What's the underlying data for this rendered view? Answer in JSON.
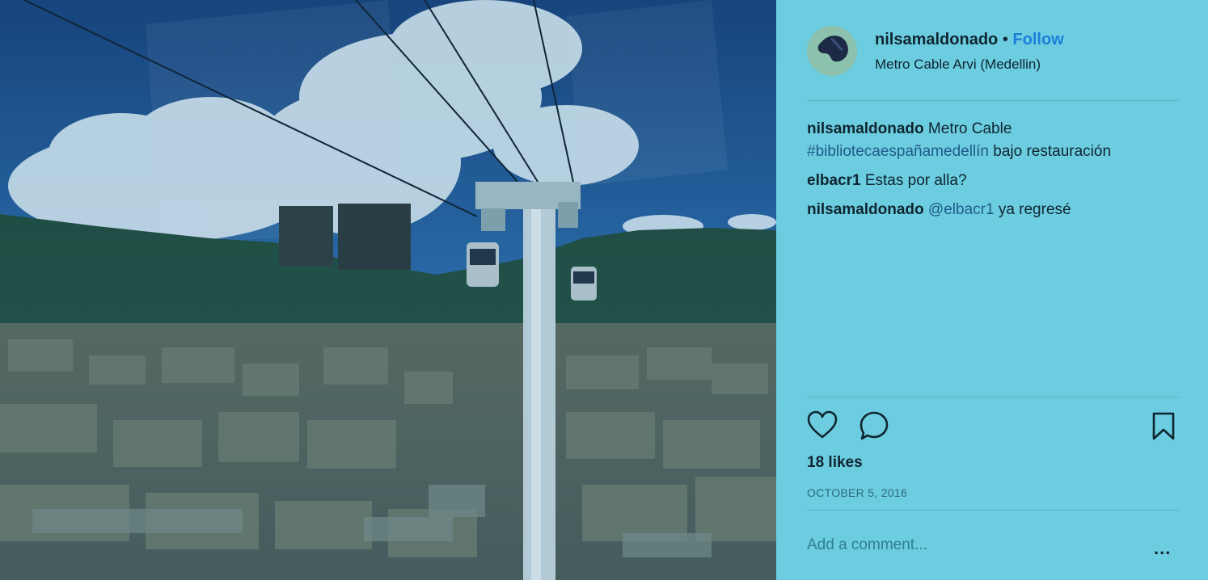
{
  "post": {
    "username": "nilsamaldonado",
    "separator": "•",
    "follow_label": "Follow",
    "location": "Metro Cable Arvi (Medellin)"
  },
  "comments": [
    {
      "user": "nilsamaldonado",
      "text_1": "Metro Cable",
      "hashtag": "#bibliotecaespañamedellín",
      "text_2": "bajo restauración"
    },
    {
      "user": "elbacr1",
      "text": "Estas por alla?"
    },
    {
      "user": "nilsamaldonado",
      "mention": "@elbacr1",
      "text": "ya regresé"
    }
  ],
  "stats": {
    "likes": "18 likes",
    "date": "OCTOBER 5, 2016"
  },
  "comment_box": {
    "placeholder": "Add a comment...",
    "more_label": "..."
  },
  "icons": {
    "like": "heart-icon",
    "comment": "comment-bubble-icon",
    "save": "bookmark-icon",
    "more": "more-options-icon"
  },
  "colors": {
    "panel_bg": "#6ccde0",
    "follow": "#1b7ed8",
    "hashtag": "#215a8a"
  }
}
